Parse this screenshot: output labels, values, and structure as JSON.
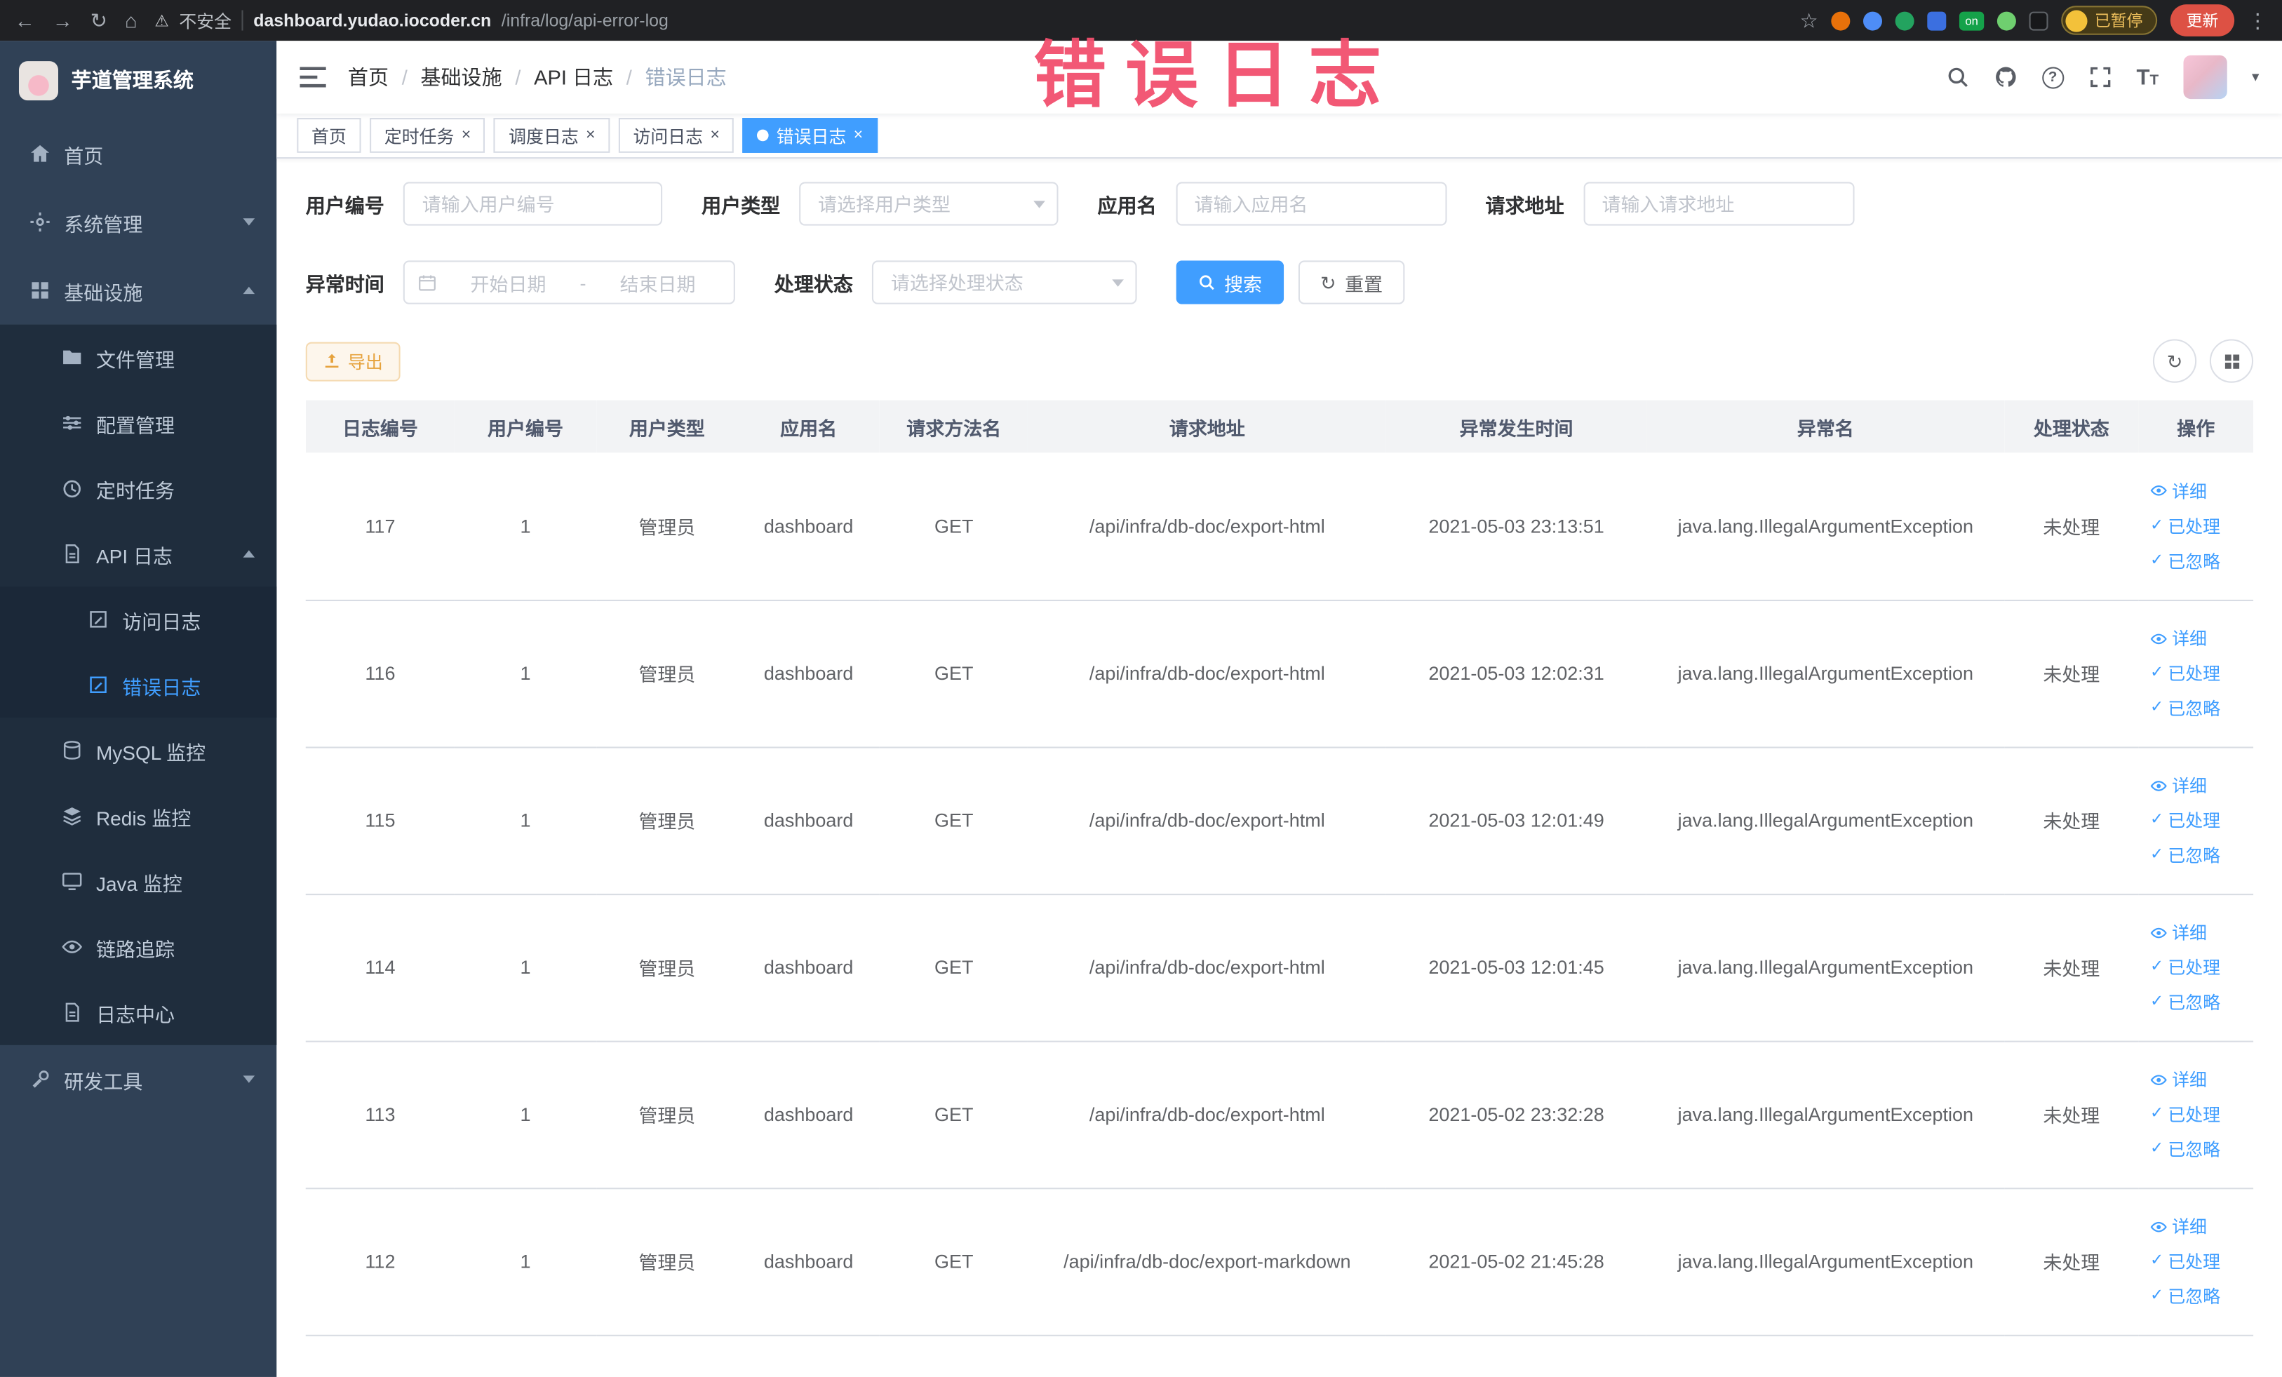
{
  "glyphs": {
    "back": "←",
    "forward": "→",
    "reload": "↻",
    "home": "⌂",
    "warning": "⚠",
    "star": "☆",
    "kebab": "⋮",
    "question": "?",
    "close": "×",
    "caret": "▾",
    "check": "✓",
    "font_t_big": "T",
    "font_t_small": "T",
    "ext_on": "on"
  },
  "browser": {
    "security_label": "不安全",
    "url_host": "dashboard.yudao.iocoder.cn",
    "url_path": "/infra/log/api-error-log",
    "paused_badge": "已暂停",
    "update_button": "更新"
  },
  "annotation": "错误日志",
  "app": {
    "logo_title": "芋道管理系统"
  },
  "sidebar": {
    "items": [
      {
        "label": "首页"
      },
      {
        "label": "系统管理"
      },
      {
        "label": "基础设施"
      },
      {
        "label": "文件管理"
      },
      {
        "label": "配置管理"
      },
      {
        "label": "定时任务"
      },
      {
        "label": "API 日志"
      },
      {
        "label": "访问日志"
      },
      {
        "label": "错误日志"
      },
      {
        "label": "MySQL 监控"
      },
      {
        "label": "Redis 监控"
      },
      {
        "label": "Java 监控"
      },
      {
        "label": "链路追踪"
      },
      {
        "label": "日志中心"
      },
      {
        "label": "研发工具"
      }
    ]
  },
  "breadcrumb": {
    "separator": "/",
    "items": [
      "首页",
      "基础设施",
      "API 日志",
      "错误日志"
    ]
  },
  "tabs": [
    {
      "label": "首页"
    },
    {
      "label": "定时任务"
    },
    {
      "label": "调度日志"
    },
    {
      "label": "访问日志"
    },
    {
      "label": "错误日志"
    }
  ],
  "filters": {
    "user_id": {
      "label": "用户编号",
      "placeholder": "请输入用户编号"
    },
    "user_type": {
      "label": "用户类型",
      "placeholder": "请选择用户类型"
    },
    "app_name": {
      "label": "应用名",
      "placeholder": "请输入应用名"
    },
    "request_url": {
      "label": "请求地址",
      "placeholder": "请输入请求地址"
    },
    "exception_time": {
      "label": "异常时间",
      "start_placeholder": "开始日期",
      "separator": "-",
      "end_placeholder": "结束日期"
    },
    "process_status": {
      "label": "处理状态",
      "placeholder": "请选择处理状态"
    },
    "search_label": "搜索",
    "reset_label": "重置"
  },
  "toolbar": {
    "export_label": "导出"
  },
  "table": {
    "columns": [
      "日志编号",
      "用户编号",
      "用户类型",
      "应用名",
      "请求方法名",
      "请求地址",
      "异常发生时间",
      "异常名",
      "处理状态",
      "操作"
    ],
    "action_labels": [
      "详细",
      "已处理",
      "已忽略"
    ],
    "rows": [
      {
        "id": "117",
        "user_id": "1",
        "user_type": "管理员",
        "app": "dashboard",
        "method": "GET",
        "url": "/api/infra/db-doc/export-html",
        "time": "2021-05-03 23:13:51",
        "exception": "java.lang.IllegalArgumentException",
        "status": "未处理"
      },
      {
        "id": "116",
        "user_id": "1",
        "user_type": "管理员",
        "app": "dashboard",
        "method": "GET",
        "url": "/api/infra/db-doc/export-html",
        "time": "2021-05-03 12:02:31",
        "exception": "java.lang.IllegalArgumentException",
        "status": "未处理"
      },
      {
        "id": "115",
        "user_id": "1",
        "user_type": "管理员",
        "app": "dashboard",
        "method": "GET",
        "url": "/api/infra/db-doc/export-html",
        "time": "2021-05-03 12:01:49",
        "exception": "java.lang.IllegalArgumentException",
        "status": "未处理"
      },
      {
        "id": "114",
        "user_id": "1",
        "user_type": "管理员",
        "app": "dashboard",
        "method": "GET",
        "url": "/api/infra/db-doc/export-html",
        "time": "2021-05-03 12:01:45",
        "exception": "java.lang.IllegalArgumentException",
        "status": "未处理"
      },
      {
        "id": "113",
        "user_id": "1",
        "user_type": "管理员",
        "app": "dashboard",
        "method": "GET",
        "url": "/api/infra/db-doc/export-html",
        "time": "2021-05-02 23:32:28",
        "exception": "java.lang.IllegalArgumentException",
        "status": "未处理"
      },
      {
        "id": "112",
        "user_id": "1",
        "user_type": "管理员",
        "app": "dashboard",
        "method": "GET",
        "url": "/api/infra/db-doc/export-markdown",
        "time": "2021-05-02 21:45:28",
        "exception": "java.lang.IllegalArgumentException",
        "status": "未处理"
      }
    ]
  }
}
